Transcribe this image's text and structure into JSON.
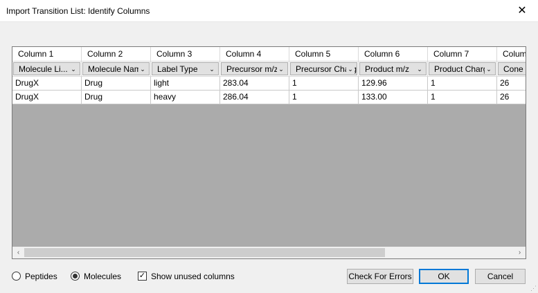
{
  "window": {
    "title": "Import Transition List: Identify Columns",
    "close_glyph": "✕"
  },
  "grid": {
    "column_titles": [
      "Column 1",
      "Column 2",
      "Column 3",
      "Column 4",
      "Column 5",
      "Column 6",
      "Column 7",
      "Column"
    ],
    "column_types": [
      "Molecule Li...",
      "Molecule Name",
      "Label Type",
      "Precursor m/z",
      "Precursor Charge",
      "Product m/z",
      "Product Charge",
      "Cone V"
    ],
    "rows": [
      [
        "DrugX",
        "Drug",
        "light",
        "283.04",
        "1",
        "129.96",
        "1",
        "26"
      ],
      [
        "DrugX",
        "Drug",
        "heavy",
        "286.04",
        "1",
        "133.00",
        "1",
        "26"
      ]
    ],
    "scroll_left": "‹",
    "scroll_right": "›",
    "dropdown_arrow": "⌄"
  },
  "options": {
    "peptides_label": "Peptides",
    "molecules_label": "Molecules",
    "molecules_selected": true,
    "show_unused_label": "Show unused columns",
    "show_unused_checked": true
  },
  "buttons": {
    "check_errors": "Check For Errors",
    "ok": "OK",
    "cancel": "Cancel"
  },
  "colors": {
    "accent": "#0078d7",
    "grid_background": "#ababab",
    "header_background": "#ffffff"
  }
}
